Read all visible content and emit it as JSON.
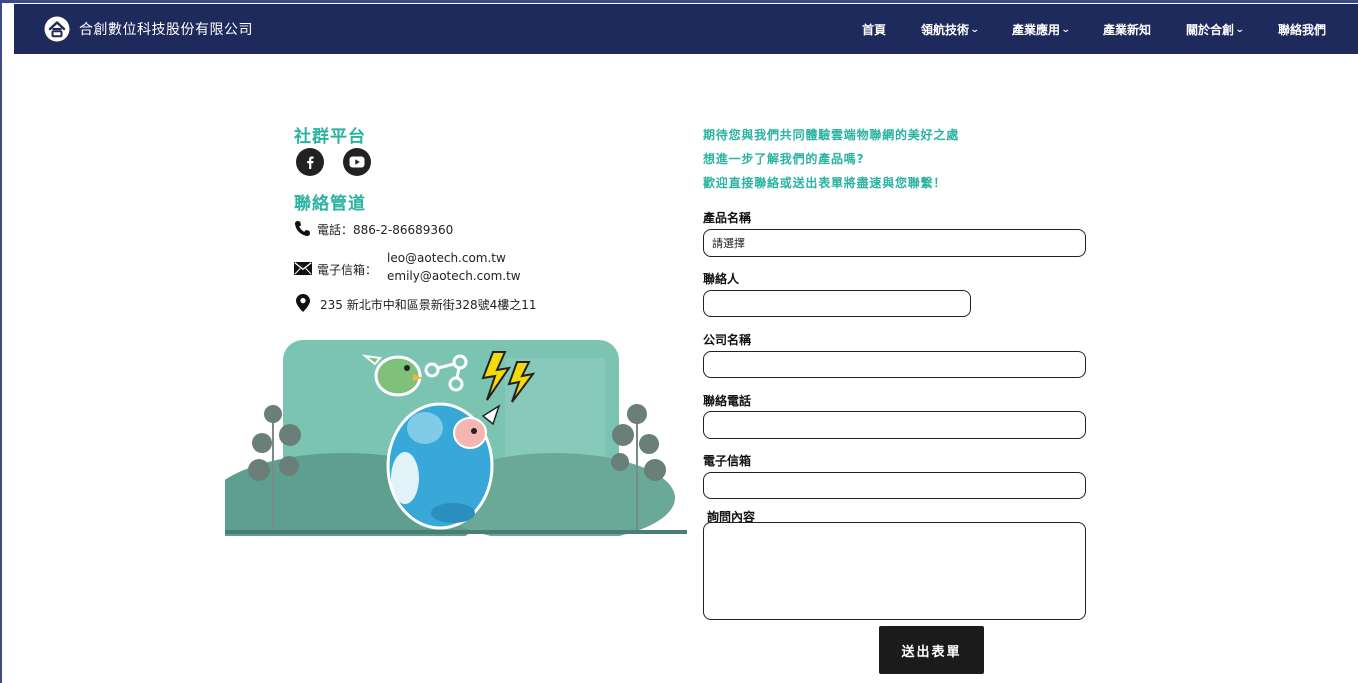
{
  "nav": {
    "brand": "合創數位科技股份有限公司",
    "items": [
      {
        "label": "首頁",
        "has_dropdown": false
      },
      {
        "label": "領航技術",
        "has_dropdown": true
      },
      {
        "label": "產業應用",
        "has_dropdown": true
      },
      {
        "label": "產業新知",
        "has_dropdown": false
      },
      {
        "label": "關於合創",
        "has_dropdown": true
      },
      {
        "label": "聯絡我們",
        "has_dropdown": false
      }
    ]
  },
  "social": {
    "title": "社群平台",
    "icons": [
      "facebook-icon",
      "youtube-icon"
    ]
  },
  "contact": {
    "title": "聯絡管道",
    "phone": "電話：886-2-86689360",
    "email_label": "電子信箱：",
    "emails": [
      "leo@aotech.com.tw",
      "emily@aotech.com.tw"
    ],
    "address": "235 新北市中和區景新街328號4樓之11"
  },
  "form": {
    "intro": [
      "期待您與我們共同體驗雲端物聯網的美好之處",
      "想進一步了解我們的產品嗎?",
      "歡迎直接聯絡或送出表單將盡速與您聯繫！"
    ],
    "product_label": "產品名稱",
    "product_value": "請選擇",
    "contact_person_label": "聯絡人",
    "company_label": "公司名稱",
    "phone_label": "聯絡電話",
    "email_label": "電子信箱",
    "inquiry_label": "詢問內容",
    "submit_label": "送出表單"
  },
  "colors": {
    "nav_bg": "#1f2a5c",
    "accent": "#2bb3a1",
    "button_bg": "#1b1b1b"
  }
}
